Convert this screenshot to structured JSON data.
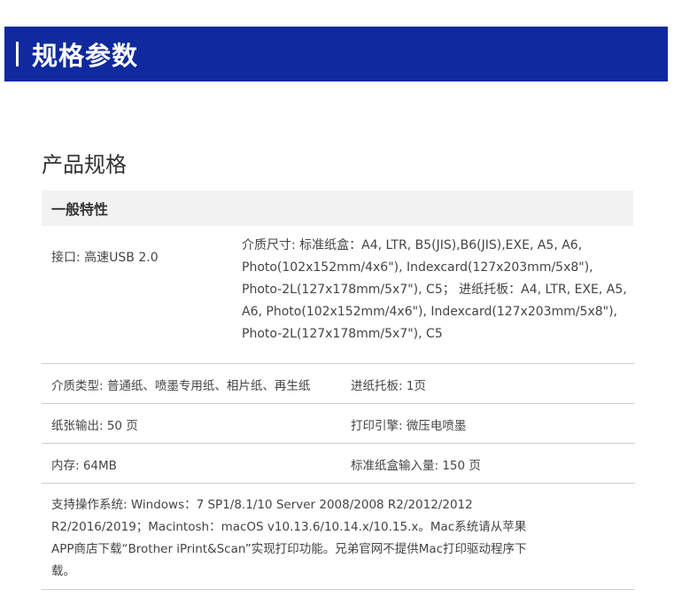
{
  "banner": {
    "title": "规格参数"
  },
  "section": {
    "title": "产品规格"
  },
  "group": {
    "title": "一般特性"
  },
  "rows": {
    "interface": "接口: 高速USB 2.0",
    "media_size": "介质尺寸: 标准纸盒：A4, LTR, B5(JIS),B6(JIS),EXE, A5, A6, Photo(102x152mm/4x6\"), Indexcard(127x203mm/5x8\"), Photo-2L(127x178mm/5x7\"), C5； 进纸托板：A4, LTR, EXE, A5, A6, Photo(102x152mm/4x6\"), Indexcard(127x203mm/5x8\"), Photo-2L(127x178mm/5x7\"), C5",
    "media_type": "介质类型: 普通纸、喷墨专用纸、相片纸、再生纸",
    "feed_tray": "进纸托板: 1页",
    "output": "纸张输出: 50 页",
    "print_engine": "打印引擎: 微压电喷墨",
    "memory": "内存: 64MB",
    "std_tray_input": "标准纸盒输入量: 150 页",
    "os_support": "支持操作系统: Windows：7 SP1/8.1/10 Server 2008/2008 R2/2012/2012 R2/2016/2019；Macintosh：macOS v10.13.6/10.14.x/10.15.x。Mac系统请从苹果APP商店下载“Brother iPrint&Scan”实现打印功能。兄弟官网不提供Mac打印驱动程序下载。"
  }
}
